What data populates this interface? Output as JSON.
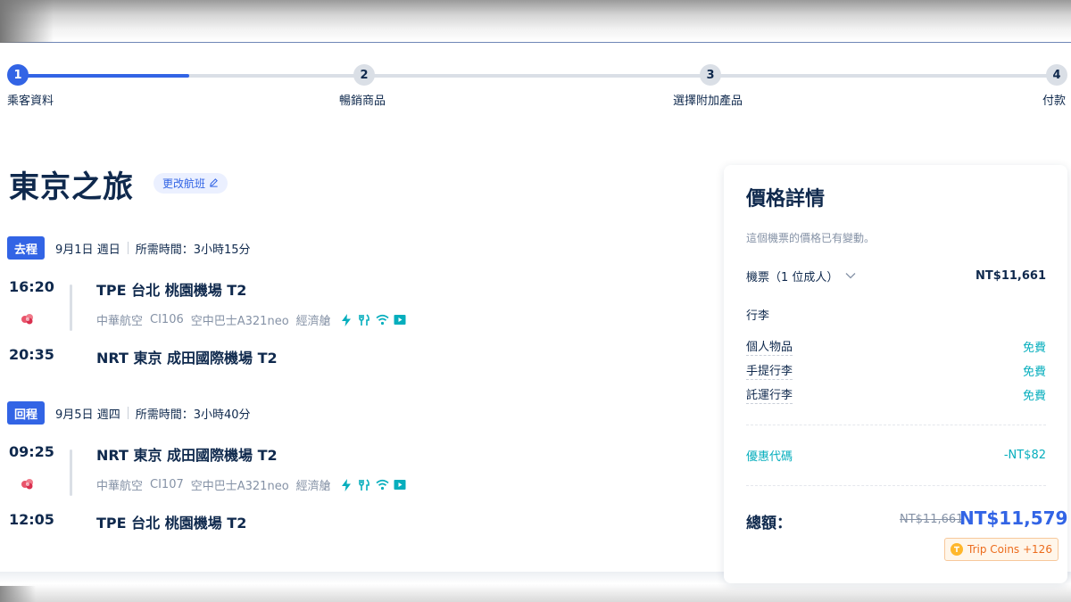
{
  "stepper": {
    "steps": [
      {
        "num": "1",
        "label": "乘客資料"
      },
      {
        "num": "2",
        "label": "暢銷商品"
      },
      {
        "num": "3",
        "label": "選擇附加產品"
      },
      {
        "num": "4",
        "label": "付款"
      }
    ],
    "active_step": 1
  },
  "trip": {
    "title": "東京之旅",
    "change_flight_label": "更改航班"
  },
  "outbound": {
    "badge": "去程",
    "date": "9月1日 週日",
    "duration": "所需時間：3小時15分",
    "depart_time": "16:20",
    "depart_airport": "TPE 台北 桃園機場 T2",
    "airline": "中華航空",
    "flight_no": "CI106",
    "aircraft": "空中巴士A321neo",
    "cabin": "經濟艙",
    "arrive_time": "20:35",
    "arrive_airport": "NRT 東京 成田國際機場 T2"
  },
  "return": {
    "badge": "回程",
    "date": "9月5日 週四",
    "duration": "所需時間：3小時40分",
    "depart_time": "09:25",
    "depart_airport": "NRT 東京 成田國際機場 T2",
    "airline": "中華航空",
    "flight_no": "CI107",
    "aircraft": "空中巴士A321neo",
    "cabin": "經濟艙",
    "arrive_time": "12:05",
    "arrive_airport": "TPE 台北 桃園機場 T2"
  },
  "amenity_icons": [
    "power-icon",
    "meal-icon",
    "wifi-icon",
    "entertainment-icon"
  ],
  "price": {
    "title": "價格詳情",
    "note": "這個機票的價格已有變動。",
    "ticket_label": "機票（1 位成人）",
    "ticket_value": "NT$11,661",
    "baggage_heading": "行李",
    "baggage": [
      {
        "label": "個人物品",
        "value": "免費"
      },
      {
        "label": "手提行李",
        "value": "免費"
      },
      {
        "label": "託運行李",
        "value": "免費"
      }
    ],
    "promo_label": "優惠代碼",
    "promo_value": "-NT$82",
    "total_label": "總額：",
    "old_total": "NT$11,661",
    "new_total": "NT$11,579",
    "coins": "Trip Coins +126"
  },
  "colors": {
    "brand_blue": "#3264e5",
    "text_dark": "#0f294d",
    "muted": "#8592a6",
    "teal": "#06aebd",
    "coin_orange": "#ec6c1d"
  }
}
